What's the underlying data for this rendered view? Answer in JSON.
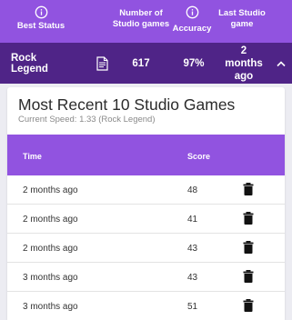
{
  "header": {
    "best_status_label": "Best Status",
    "num_games_label": "Number of Studio games",
    "accuracy_label": "Accuracy",
    "last_game_label": "Last Studio game"
  },
  "summary": {
    "best_status": "Rock Legend",
    "num_games": "617",
    "accuracy": "97%",
    "last_game": "2 months ago"
  },
  "card": {
    "title": "Most Recent 10 Studio Games",
    "subtitle": "Current Speed: 1.33 (Rock Legend)"
  },
  "table": {
    "col_time": "Time",
    "col_score": "Score",
    "rows": [
      {
        "time": "2 months ago",
        "score": "48"
      },
      {
        "time": "2 months ago",
        "score": "41"
      },
      {
        "time": "2 months ago",
        "score": "43"
      },
      {
        "time": "3 months ago",
        "score": "43"
      },
      {
        "time": "3 months ago",
        "score": "51"
      }
    ]
  },
  "colors": {
    "header_bg": "#9153e0",
    "summary_bg": "#4f2487",
    "page_bg": "#ececf2"
  },
  "icons": [
    "info-icon",
    "document-icon",
    "chevron-up-icon",
    "trash-icon"
  ]
}
